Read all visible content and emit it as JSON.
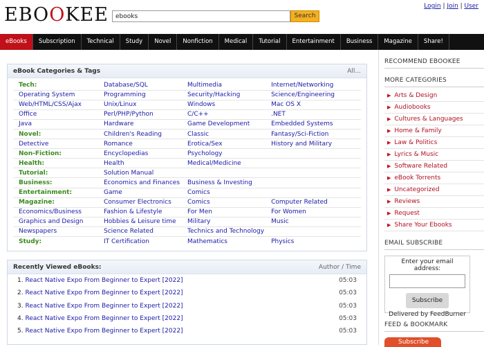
{
  "header": {
    "logo_part1": "EBO",
    "logo_part2": "O",
    "logo_part3": "KEE",
    "search_value": "ebooks",
    "search_button": "Search",
    "login": "Login",
    "join": "Join",
    "user": "User",
    "sep": " | "
  },
  "nav": {
    "tabs": [
      "eBooks",
      "Subscription",
      "Technical",
      "Study",
      "Novel",
      "Nonfiction",
      "Medical",
      "Tutorial",
      "Entertainment",
      "Business",
      "Magazine",
      "Share!"
    ]
  },
  "categories": {
    "title": "eBook Categories & Tags",
    "all": "All...",
    "rows": [
      [
        "Tech:",
        "Database/SQL",
        "Multimedia",
        "Internet/Networking"
      ],
      [
        "Operating System",
        "Programming",
        "Security/Hacking",
        "Science/Engineering"
      ],
      [
        "Web/HTML/CSS/Ajax",
        "Unix/Linux",
        "Windows",
        "Mac OS X"
      ],
      [
        "Office",
        "Perl/PHP/Python",
        "C/C++",
        ".NET"
      ],
      [
        "Java",
        "Hardware",
        "Game Development",
        "Embedded Systems"
      ],
      [
        "Novel:",
        "Children's Reading",
        "Classic",
        "Fantasy/Sci-Fiction"
      ],
      [
        "Detective",
        "Romance",
        "Erotica/Sex",
        "History and Military"
      ],
      [
        "Non-Fiction:",
        "Encyclopedias",
        "Psychology",
        ""
      ],
      [
        "Health:",
        "Health",
        "Medical/Medicine",
        ""
      ],
      [
        "Tutorial:",
        "Solution Manual",
        "",
        ""
      ],
      [
        "Business:",
        "Economics and Finances",
        "Business & Investing",
        ""
      ],
      [
        "Entertainment:",
        "Game",
        "Comics",
        ""
      ],
      [
        "Magazine:",
        "Consumer Electronics",
        "Comics",
        "Computer Related"
      ],
      [
        "Economics/Business",
        "Fashion & Lifestyle",
        "For Men",
        "For Women"
      ],
      [
        "Graphics and Design",
        "Hobbies & Leisure time",
        "Military",
        "Music"
      ],
      [
        "Newspapers",
        "Science Related",
        "Technics and Technology",
        ""
      ],
      [
        "Study:",
        "IT Certification",
        "Mathematics",
        "Physics"
      ]
    ]
  },
  "recent": {
    "title": "Recently Viewed eBooks:",
    "right": "Author / Time",
    "items": [
      {
        "num": "1.",
        "title": "React Native Expo From Beginner to Expert [2022]",
        "time": "05:03"
      },
      {
        "num": "2.",
        "title": "React Native Expo From Beginner to Expert [2022]",
        "time": "05:03"
      },
      {
        "num": "3.",
        "title": "React Native Expo From Beginner to Expert [2022]",
        "time": "05:03"
      },
      {
        "num": "4.",
        "title": "React Native Expo From Beginner to Expert [2022]",
        "time": "05:03"
      },
      {
        "num": "5.",
        "title": "React Native Expo From Beginner to Expert [2022]",
        "time": "05:03"
      }
    ]
  },
  "sidebar": {
    "recommend": "RECOMMEND EBOOKEE",
    "more_categories": "MORE CATEGORIES",
    "items": [
      "Arts & Design",
      "Audiobooks",
      "Cultures & Languages",
      "Home & Family",
      "Law & Politics",
      "Lyrics & Music",
      "Software Related",
      "eBook Torrents",
      "Uncategorized",
      "Reviews",
      "Request",
      "Share Your Ebooks"
    ],
    "email_title": "EMAIL SUBSCRIBE",
    "email_label": "Enter your email address:",
    "subscribe": "Subscribe",
    "delivered": "Delivered by FeedBurner",
    "feed_title": "FEED & BOOKMARK",
    "rss": "Subscribe"
  },
  "colors": {
    "brand_red": "#c0101a",
    "nav_bg": "#111111",
    "search_button": "#f4b020",
    "heading_green": "#3a8a1e",
    "link_blue": "#1a1aa6"
  }
}
